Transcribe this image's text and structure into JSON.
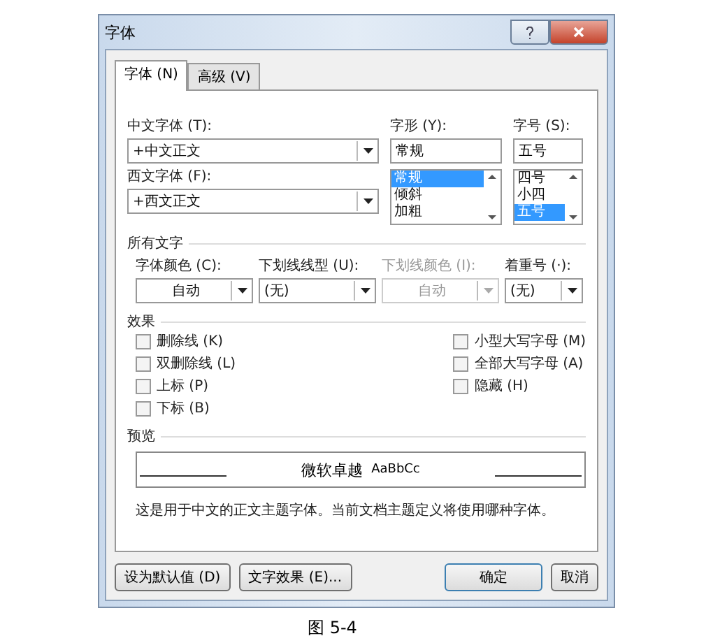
{
  "window": {
    "title": "字体"
  },
  "tabs": [
    {
      "label": "字体 (N)",
      "selected": true
    },
    {
      "label": "高级 (V)",
      "selected": false
    }
  ],
  "font_fields": [
    {
      "label": "中文字体 (T):",
      "value": "+中文正文"
    },
    {
      "label": "西文字体 (F):",
      "value": "+西文正文"
    }
  ],
  "style": {
    "label": "字形 (Y):",
    "value": "常规",
    "options": [
      {
        "label": "常规",
        "selected": true
      },
      {
        "label": "倾斜",
        "selected": false
      },
      {
        "label": "加粗",
        "selected": false
      }
    ]
  },
  "size": {
    "label": "字号 (S):",
    "value": "五号",
    "options": [
      {
        "label": "四号",
        "selected": false
      },
      {
        "label": "小四",
        "selected": false
      },
      {
        "label": "五号",
        "selected": true
      }
    ]
  },
  "all_text": {
    "heading": "所有文字",
    "dropdowns": [
      {
        "label": "字体颜色 (C):",
        "value": "自动",
        "disabled": false,
        "centered": true
      },
      {
        "label": "下划线线型 (U):",
        "value": "(无)",
        "disabled": false,
        "centered": false
      },
      {
        "label": "下划线颜色 (I):",
        "value": "自动",
        "disabled": true,
        "centered": true
      },
      {
        "label": "着重号 (·):",
        "value": "(无)",
        "disabled": false,
        "centered": false
      }
    ]
  },
  "effects": {
    "heading": "效果",
    "columns": [
      [
        {
          "label": "删除线 (K)",
          "checked": false
        },
        {
          "label": "双删除线 (L)",
          "checked": false
        },
        {
          "label": "上标 (P)",
          "checked": false
        },
        {
          "label": "下标 (B)",
          "checked": false
        }
      ],
      [
        {
          "label": "小型大写字母 (M)",
          "checked": false
        },
        {
          "label": "全部大写字母 (A)",
          "checked": false
        },
        {
          "label": "隐藏 (H)",
          "checked": false
        }
      ]
    ]
  },
  "preview": {
    "heading": "预览",
    "sample_cjk": "微软卓越",
    "sample_latin": "AaBbCc",
    "description": "这是用于中文的正文主题字体。当前文档主题定义将使用哪种字体。"
  },
  "buttons": [
    {
      "label": "设为默认值 (D)",
      "primary": false
    },
    {
      "label": "文字效果 (E)...",
      "primary": false
    },
    {
      "label": "确定",
      "primary": true
    },
    {
      "label": "取消",
      "primary": false
    }
  ],
  "caption": "图 5-4"
}
